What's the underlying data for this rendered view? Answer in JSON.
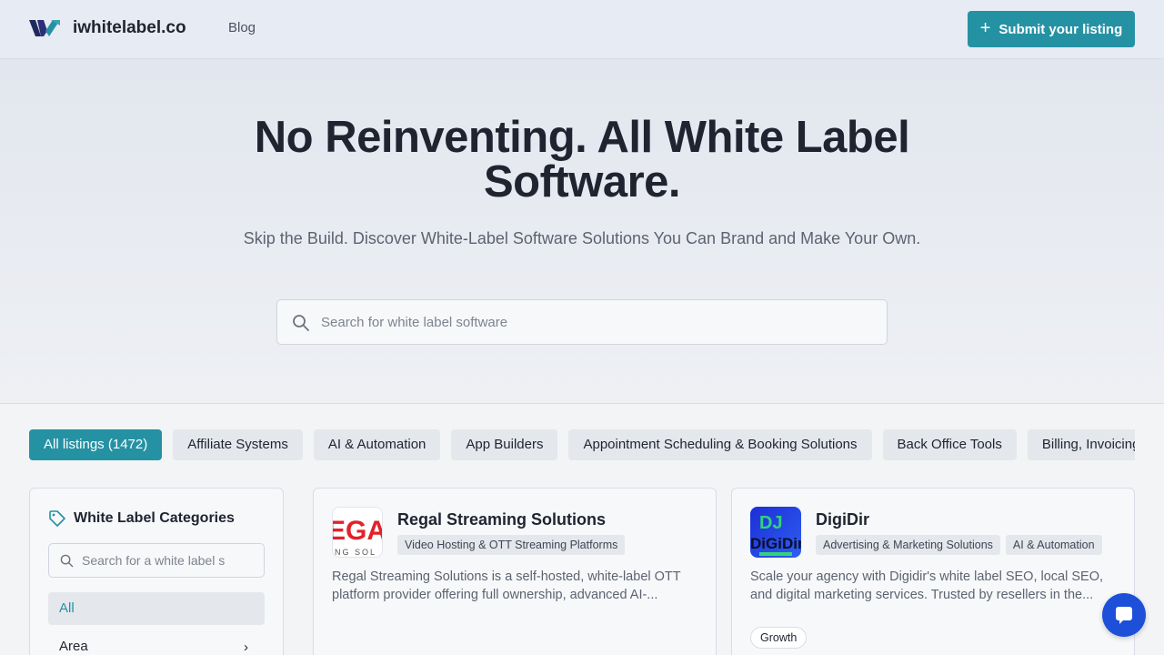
{
  "header": {
    "brand": "iwhitelabel.co",
    "nav_blog": "Blog",
    "submit_label": "Submit your listing"
  },
  "hero": {
    "title": "No Reinventing. All White Label Software.",
    "subtitle": "Skip the Build. Discover White-Label Software Solutions You Can Brand and Make Your Own.",
    "search_placeholder": "Search for white label software"
  },
  "chips": [
    {
      "label": "All listings (1472)",
      "active": true
    },
    {
      "label": "Affiliate Systems"
    },
    {
      "label": "AI & Automation"
    },
    {
      "label": "App Builders"
    },
    {
      "label": "Appointment Scheduling & Booking Solutions"
    },
    {
      "label": "Back Office Tools"
    },
    {
      "label": "Billing, Invoicing"
    }
  ],
  "sidebar": {
    "title": "White Label Categories",
    "search_placeholder": "Search for a white label s",
    "items": [
      {
        "label": "All"
      },
      {
        "label": "Area"
      }
    ]
  },
  "listings": [
    {
      "name": "Regal Streaming Solutions",
      "thumb_text": "EGA",
      "thumb_sub": "NG SOL",
      "tags": [
        "Video Hosting & OTT Streaming Platforms"
      ],
      "description": "Regal Streaming Solutions is a self-hosted, white-label OTT platform provider offering full ownership, advanced AI-..."
    },
    {
      "name": "DigiDir",
      "thumb_text": "DiGiDir",
      "thumb_sub": "DJ",
      "tags": [
        "Advertising & Marketing Solutions",
        "AI & Automation"
      ],
      "description": "Scale your agency with Digidir's white label SEO, local SEO, and digital marketing services. Trusted by resellers in the...",
      "badge": "Growth"
    }
  ],
  "colors": {
    "accent": "#2592a4",
    "chat": "#1d4fd9"
  }
}
